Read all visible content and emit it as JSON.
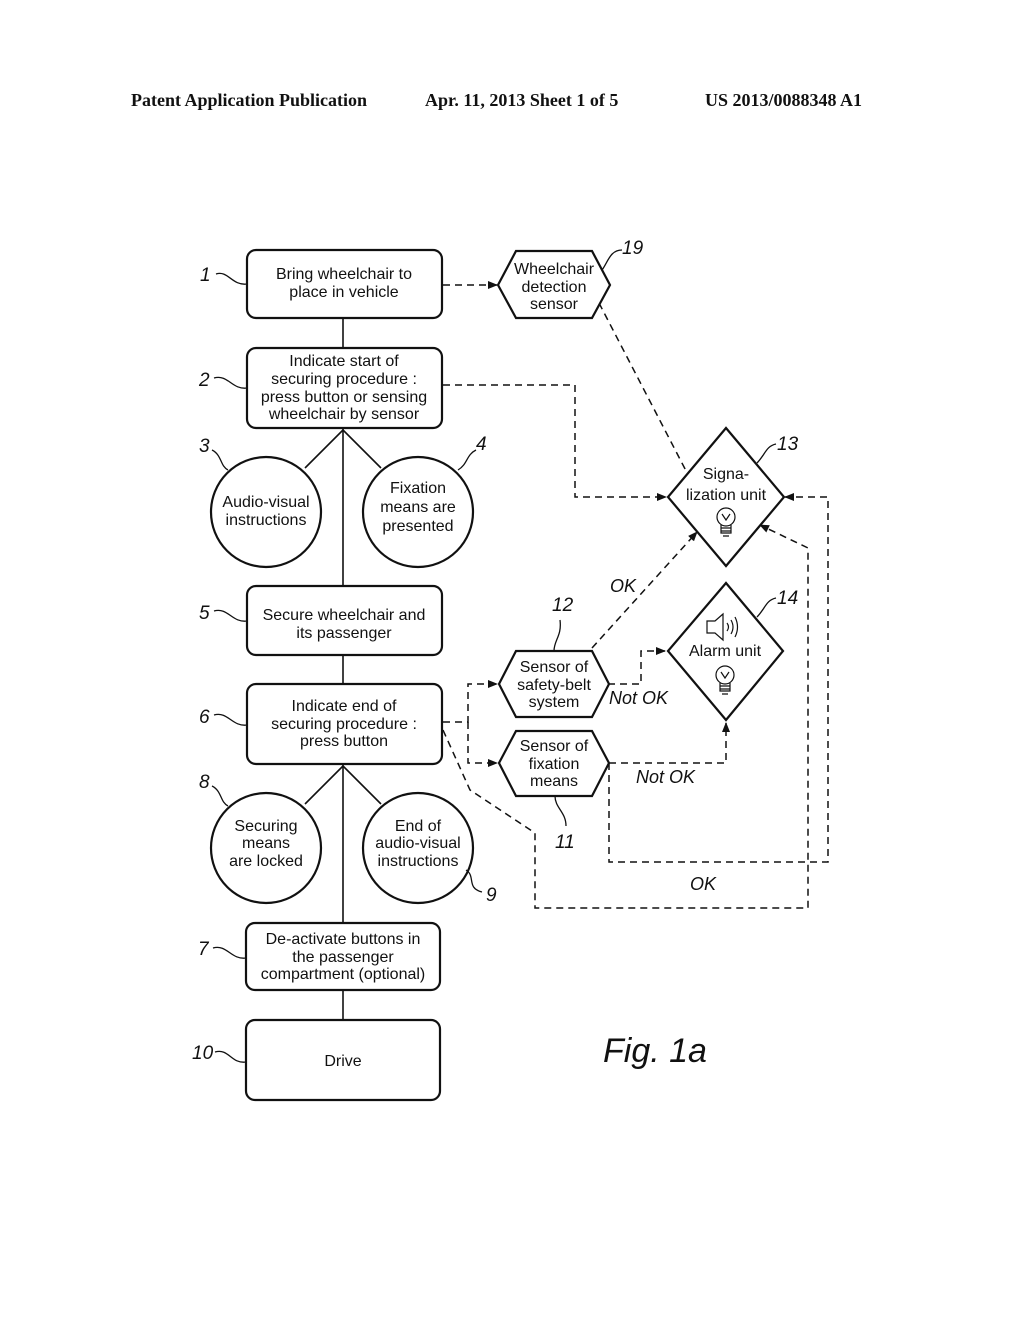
{
  "header": {
    "left": "Patent Application Publication",
    "middle": "Apr. 11, 2013  Sheet 1 of 5",
    "right": "US 2013/0088348 A1"
  },
  "figure_label": "Fig. 1a",
  "nodes": {
    "n1": {
      "ref": "1",
      "lines": [
        "Bring wheelchair to",
        "place in vehicle"
      ]
    },
    "n2": {
      "ref": "2",
      "lines": [
        "Indicate start of",
        "securing procedure :",
        "press button or sensing",
        "wheelchair by sensor"
      ]
    },
    "n3": {
      "ref": "3",
      "lines": [
        "Audio-visual",
        "instructions"
      ]
    },
    "n4": {
      "ref": "4",
      "lines": [
        "Fixation",
        "means are",
        "presented"
      ]
    },
    "n5": {
      "ref": "5",
      "lines": [
        "Secure wheelchair and",
        "its passenger"
      ]
    },
    "n6": {
      "ref": "6",
      "lines": [
        "Indicate end of",
        "securing procedure :",
        "press button"
      ]
    },
    "n7": {
      "ref": "7",
      "lines": [
        "De-activate buttons in",
        "the passenger",
        "compartment (optional)"
      ]
    },
    "n8": {
      "ref": "8",
      "lines": [
        "Securing",
        "means",
        "are locked"
      ]
    },
    "n9": {
      "ref": "9",
      "lines": [
        "End of",
        "audio-visual",
        "instructions"
      ]
    },
    "n10": {
      "ref": "10",
      "lines": [
        "Drive"
      ]
    },
    "n11": {
      "ref": "11",
      "lines": [
        "Sensor of",
        "fixation",
        "means"
      ]
    },
    "n12": {
      "ref": "12",
      "lines": [
        "Sensor of",
        "safety-belt",
        "system"
      ]
    },
    "n13": {
      "ref": "13",
      "lines": [
        "Signa-",
        "lization unit"
      ],
      "icon": "light-bulb-icon"
    },
    "n14": {
      "ref": "14",
      "lines": [
        "Alarm unit"
      ],
      "icons": [
        "speaker-icon",
        "light-bulb-icon"
      ]
    },
    "n19": {
      "ref": "19",
      "lines": [
        "Wheelchair",
        "detection",
        "sensor"
      ]
    }
  },
  "edge_labels": {
    "belt_ok": "OK",
    "belt_not_ok": "Not OK",
    "fixation_not_ok": "Not OK",
    "fixation_ok": "OK"
  }
}
